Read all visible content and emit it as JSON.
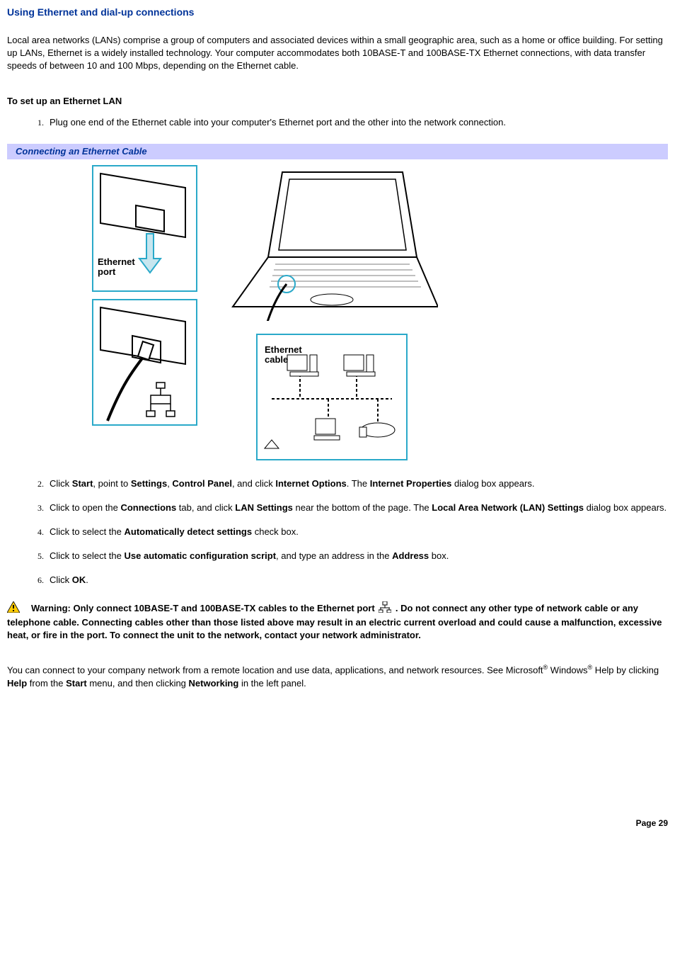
{
  "title": "Using Ethernet and dial-up connections",
  "intro": "Local area networks (LANs) comprise a group of computers and associated devices within a small geographic area, such as a home or office building. For setting up LANs, Ethernet is a widely installed technology. Your computer accommodates both 10BASE-T and 100BASE-TX Ethernet connections, with data transfer speeds of between 10 and 100 Mbps, depending on the Ethernet cable.",
  "subheading": "To set up an Ethernet LAN",
  "step1": "Plug one end of the Ethernet cable into your computer's Ethernet port and the other into the network connection.",
  "caption": "Connecting an Ethernet Cable",
  "fig_label_port_line1": "Ethernet",
  "fig_label_port_line2": "port",
  "fig_label_cable_line1": "Ethernet",
  "fig_label_cable_line2": "cable",
  "step2_a": "Click ",
  "step2_b_start": "Start",
  "step2_c": ", point to ",
  "step2_settings": "Settings",
  "step2_comma": ", ",
  "step2_cp": "Control Panel",
  "step2_d": ", and click ",
  "step2_io": "Internet Options",
  "step2_e": ". The ",
  "step2_ip": "Internet Properties",
  "step2_f": " dialog box appears.",
  "step3_a": "Click to open the ",
  "step3_conn": "Connections",
  "step3_b": " tab, and click ",
  "step3_lan": "LAN Settings",
  "step3_c": " near the bottom of the page. The ",
  "step3_lans": "Local Area Network (LAN) Settings",
  "step3_d": " dialog box appears.",
  "step4_a": "Click to select the ",
  "step4_b": "Automatically detect settings",
  "step4_c": " check box.",
  "step5_a": "Click to select the ",
  "step5_b": "Use automatic configuration script",
  "step5_c": ", and type an address in the ",
  "step5_d": "Address",
  "step5_e": " box.",
  "step6_a": "Click ",
  "step6_b": "OK",
  "step6_c": ".",
  "warn_a": "Warning: Only connect 10BASE-T and 100BASE-TX cables to the Ethernet port ",
  "warn_b": " . Do not connect any other type of network cable or any telephone cable. Connecting cables other than those listed above may result in an electric current overload and could cause a malfunction, excessive heat, or fire in the port. To connect the unit to the network, contact your network administrator.",
  "closing_a": "You can connect to your company network from a remote location and use data, applications, and network resources. See Microsoft",
  "closing_reg": "®",
  "closing_b": " Windows",
  "closing_c": " Help by clicking ",
  "closing_help": "Help",
  "closing_d": " from the ",
  "closing_start": "Start",
  "closing_e": " menu, and then clicking ",
  "closing_net": "Networking",
  "closing_f": " in the left panel.",
  "page_number": "Page 29"
}
